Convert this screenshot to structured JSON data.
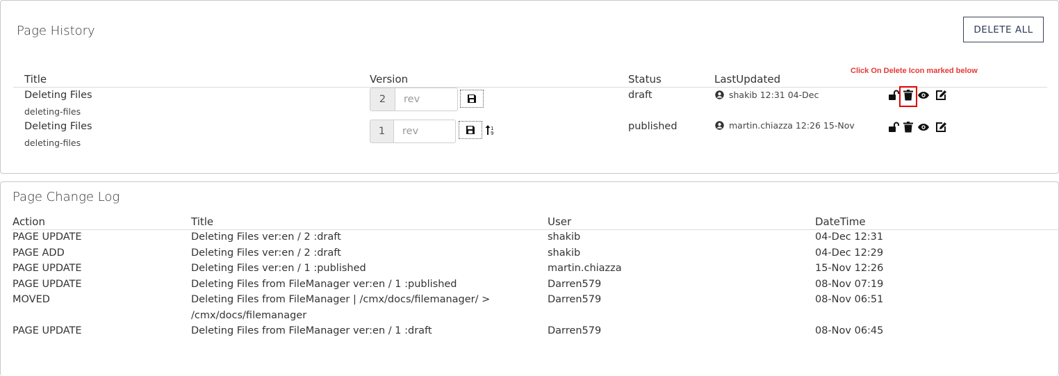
{
  "history": {
    "title": "Page History",
    "delete_all_label": "DELETE ALL",
    "hint": "Click On Delete Icon marked below",
    "columns": {
      "title": "Title",
      "version": "Version",
      "status": "Status",
      "last_updated": "LastUpdated"
    },
    "rows": [
      {
        "title": "Deleting Files",
        "slug": "deleting-files",
        "version": "2",
        "rev_placeholder": "rev",
        "status": "draft",
        "updated": "shakib 12:31 04-Dec"
      },
      {
        "title": "Deleting Files",
        "slug": "deleting-files",
        "version": "1",
        "rev_placeholder": "rev",
        "status": "published",
        "updated": "martin.chiazza 12:26 15-Nov"
      }
    ]
  },
  "changelog": {
    "title": "Page Change Log",
    "columns": {
      "action": "Action",
      "title": "Title",
      "user": "User",
      "datetime": "DateTime"
    },
    "rows": [
      {
        "action": "PAGE UPDATE",
        "title": "Deleting Files ver:en / 2 :draft",
        "title2": "",
        "user": "shakib",
        "datetime": "04-Dec 12:31"
      },
      {
        "action": "PAGE ADD",
        "title": "Deleting Files ver:en / 2 :draft",
        "title2": "",
        "user": "shakib",
        "datetime": "04-Dec 12:29"
      },
      {
        "action": "PAGE UPDATE",
        "title": "Deleting Files ver:en / 1 :published",
        "title2": "",
        "user": "martin.chiazza",
        "datetime": "15-Nov 12:26"
      },
      {
        "action": "PAGE UPDATE",
        "title": "Deleting Files from FileManager ver:en / 1 :published",
        "title2": "",
        "user": "Darren579",
        "datetime": "08-Nov 07:19"
      },
      {
        "action": "MOVED",
        "title": "Deleting Files from FileManager | /cmx/docs/filemanager/ >",
        "title2": "/cmx/docs/filemanager",
        "user": "Darren579",
        "datetime": "08-Nov 06:51"
      },
      {
        "action": "PAGE UPDATE",
        "title": "Deleting Files from FileManager ver:en / 1 :draft",
        "title2": "",
        "user": "Darren579",
        "datetime": "08-Nov 06:45"
      }
    ]
  },
  "icons": {
    "save": "floppy-disk-icon",
    "sort": "sort-icon",
    "unlock": "unlock-icon",
    "trash": "trash-icon",
    "view": "eye-icon",
    "edit": "edit-icon",
    "user": "user-circle-icon"
  },
  "colors": {
    "highlight": "#e00000",
    "hint": "#e53935",
    "button_border": "#3b4352"
  }
}
